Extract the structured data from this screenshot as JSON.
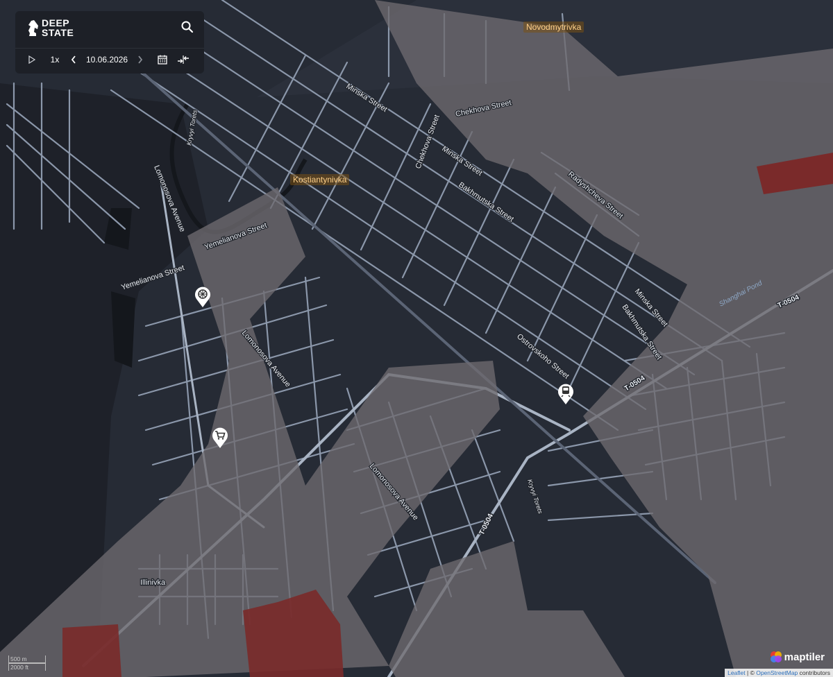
{
  "app": {
    "logo_line1": "DEEP",
    "logo_line2": "STATE",
    "play_speed": "1x",
    "date": "10.06.2026"
  },
  "colors": {
    "background": "#262b35",
    "gray_zone": "#67646a",
    "red_zone": "#7a2a2a",
    "streets": "#8b97aa",
    "panel": "#1d2027"
  },
  "icons": [
    "play-icon",
    "chevron-left-icon",
    "chevron-right-icon",
    "calendar-icon",
    "compare-icon",
    "search-icon",
    "ferris-wheel-icon",
    "train-icon",
    "shopping-cart-icon"
  ],
  "places": {
    "novodmytrivka": "Novodmytrivka",
    "kostiantynivka": "Kostiantynivka",
    "illinivka": "Illinivka"
  },
  "streets": {
    "minska_1": "Minska Street",
    "chekhova_1": "Chekhova Street",
    "chekhova_2": "Chekhova Street",
    "minska_2": "Minska Street",
    "bakhmutska_1": "Bakhmutska Street",
    "radyshcheva": "Radyshcheva Street",
    "kryvyi_torets_1": "Kryvyi Torets",
    "lomonosova_1": "Lomonosova Avenue",
    "yemelianova_1": "Yemelianova Street",
    "yemelianova_2": "Yemelianova Street",
    "lomonosova_2": "Lomonosova Avenue",
    "lomonosova_3": "Lomonosova Avenue",
    "ostrovskoho": "Ostrovskoho Street",
    "minska_3": "Minska Street",
    "bakhmutska_2": "Bakhmutska Street",
    "kryvyi_torets_2": "Kryvyi Torets"
  },
  "roads": {
    "t0504_a": "T-0504",
    "t0504_b": "T-0504",
    "t0504_c": "T-0504"
  },
  "water": {
    "shanghai_pond": "Shanghai Pond"
  },
  "scale": {
    "metric": "500 m",
    "imperial": "2000 ft"
  },
  "attribution": {
    "brand": "maptiler",
    "leaflet": "Leaflet",
    "separator": " | © ",
    "osm": "OpenStreetMap",
    "contributors": " contributors"
  }
}
